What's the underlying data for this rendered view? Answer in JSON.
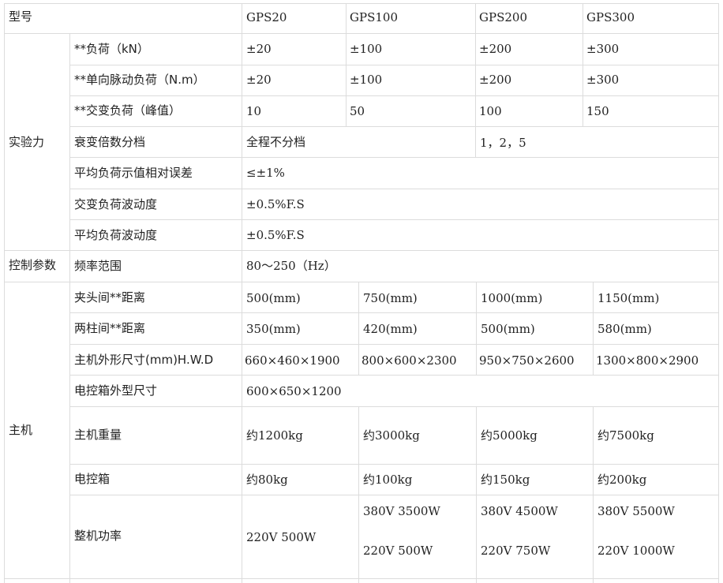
{
  "header": {
    "model_label": "型号",
    "models": [
      "GPS20",
      "GPS100",
      "GPS200",
      "GPS300"
    ]
  },
  "groups": {
    "test_force": "实验力",
    "control_params": "控制参数",
    "main_unit": "主机"
  },
  "rows": {
    "load": {
      "label": "**负荷（kN）",
      "values": [
        "±20",
        "±100",
        "±200",
        "±300"
      ]
    },
    "pulse_load": {
      "label": "**单向脉动负荷（N.m）",
      "values": [
        "±20",
        "±100",
        "±200",
        "±300"
      ]
    },
    "alt_load": {
      "label": "**交变负荷（峰值）",
      "values": [
        "10",
        "50",
        "100",
        "150"
      ]
    },
    "attenuation": {
      "label": "衰变倍数分档",
      "value_a": "全程不分档",
      "value_b": "1，2，5"
    },
    "avg_error": {
      "label": "平均负荷示值相对误差",
      "value": "≤±1%"
    },
    "alt_fluct": {
      "label": "交变负荷波动度",
      "value": "±0.5%F.S"
    },
    "avg_fluct": {
      "label": "平均负荷波动度",
      "value": "±0.5%F.S"
    },
    "freq": {
      "label": "频率范围",
      "value": "80～250（Hz）"
    },
    "clamp_dist": {
      "label": "夹头间**距离",
      "values": [
        "500(mm)",
        "750(mm)",
        "1000(mm)",
        "1150(mm)"
      ]
    },
    "column_dist": {
      "label": "两柱间**距离",
      "values": [
        "350(mm)",
        "420(mm)",
        "500(mm)",
        "580(mm)"
      ]
    },
    "dims": {
      "label": "主机外形尺寸(mm)H.W.D",
      "values": [
        "660×460×1900",
        "800×600×2300",
        "950×750×2600",
        "1300×800×2900"
      ]
    },
    "cabinet_dims": {
      "label": "电控箱外型尺寸",
      "value": "600×650×1200"
    },
    "weight": {
      "label": "主机重量",
      "values": [
        "约1200kg",
        "约3000kg",
        "约5000kg",
        "约7500kg"
      ]
    },
    "cabinet": {
      "label": "电控箱",
      "values": [
        "约80kg",
        "约100kg",
        "约150kg",
        "约200kg"
      ]
    },
    "power": {
      "label": "整机功率",
      "col1": "220V 500W",
      "col2": [
        "380V 3500W",
        "220V 500W"
      ],
      "col3": [
        "380V 4500W",
        "220V 750W"
      ],
      "col4": [
        "380V 5500W",
        "220V 1000W"
      ]
    }
  }
}
